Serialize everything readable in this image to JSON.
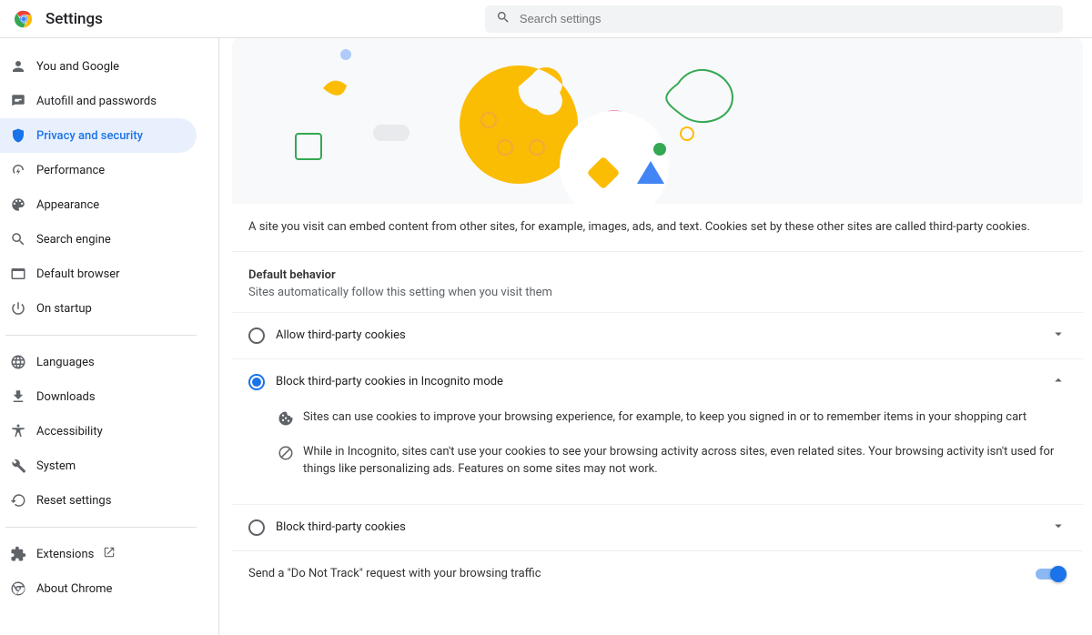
{
  "header": {
    "title": "Settings",
    "search_placeholder": "Search settings"
  },
  "sidebar": {
    "items": [
      {
        "id": "you-and-google",
        "label": "You and Google",
        "icon": "person"
      },
      {
        "id": "autofill",
        "label": "Autofill and passwords",
        "icon": "autofill"
      },
      {
        "id": "privacy",
        "label": "Privacy and security",
        "icon": "shield",
        "selected": true
      },
      {
        "id": "performance",
        "label": "Performance",
        "icon": "speed"
      },
      {
        "id": "appearance",
        "label": "Appearance",
        "icon": "palette"
      },
      {
        "id": "search-engine",
        "label": "Search engine",
        "icon": "search"
      },
      {
        "id": "default-browser",
        "label": "Default browser",
        "icon": "browser"
      },
      {
        "id": "on-startup",
        "label": "On startup",
        "icon": "power"
      }
    ],
    "advanced": [
      {
        "id": "languages",
        "label": "Languages",
        "icon": "globe"
      },
      {
        "id": "downloads",
        "label": "Downloads",
        "icon": "download"
      },
      {
        "id": "accessibility",
        "label": "Accessibility",
        "icon": "accessibility"
      },
      {
        "id": "system",
        "label": "System",
        "icon": "wrench"
      },
      {
        "id": "reset",
        "label": "Reset settings",
        "icon": "restore"
      }
    ],
    "footer": [
      {
        "id": "extensions",
        "label": "Extensions",
        "icon": "extension",
        "ext": true
      },
      {
        "id": "about",
        "label": "About Chrome",
        "icon": "chrome-outline"
      }
    ]
  },
  "content": {
    "description": "A site you visit can embed content from other sites, for example, images, ads, and text. Cookies set by these other sites are called third-party cookies.",
    "section_title": "Default behavior",
    "section_sub": "Sites automatically follow this setting when you visit them",
    "options": [
      {
        "id": "allow-3p",
        "label": "Allow third-party cookies",
        "checked": false,
        "expanded": false
      },
      {
        "id": "block-3p-incognito",
        "label": "Block third-party cookies in Incognito mode",
        "checked": true,
        "expanded": true,
        "details": [
          {
            "icon": "cookie",
            "text": "Sites can use cookies to improve your browsing experience, for example, to keep you signed in or to remember items in your shopping cart"
          },
          {
            "icon": "block",
            "text": "While in Incognito, sites can't use your cookies to see your browsing activity across sites, even related sites. Your browsing activity isn't used for things like personalizing ads. Features on some sites may not work."
          }
        ]
      },
      {
        "id": "block-3p",
        "label": "Block third-party cookies",
        "checked": false,
        "expanded": false
      }
    ],
    "dnt": {
      "label": "Send a \"Do Not Track\" request with your browsing traffic",
      "enabled": true
    }
  }
}
